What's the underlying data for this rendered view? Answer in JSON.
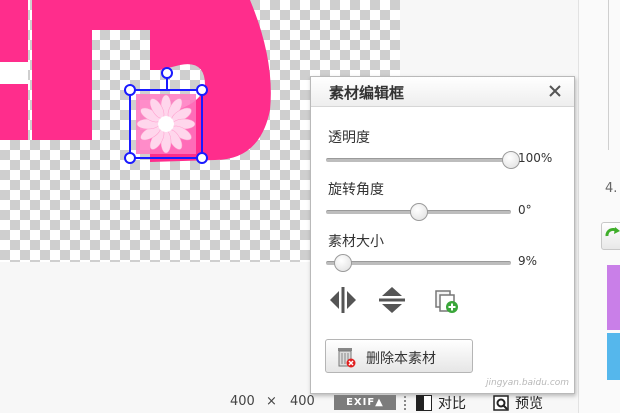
{
  "panel": {
    "title": "素材编辑框",
    "sliders": [
      {
        "label": "透明度",
        "value": 100,
        "value_text": "100%"
      },
      {
        "label": "旋转角度",
        "value": 0.5,
        "value_text": "0°"
      },
      {
        "label": "素材大小",
        "value": 0.09,
        "value_text": "9%"
      }
    ],
    "delete_label": "删除本素材"
  },
  "status_bar": {
    "width": "400",
    "separator": "×",
    "height": "400",
    "exif_label": "EXIF▲",
    "compare_label": "对比",
    "preview_label": "预览"
  },
  "right_strip": {
    "number": "4."
  },
  "watermark": "jingyan.baidu.com",
  "colors": {
    "text_pink": "#ff2d8c",
    "selection_blue": "#1a1aff",
    "purple_bar": "#c97fe8",
    "blue_bar": "#55b7ec"
  }
}
